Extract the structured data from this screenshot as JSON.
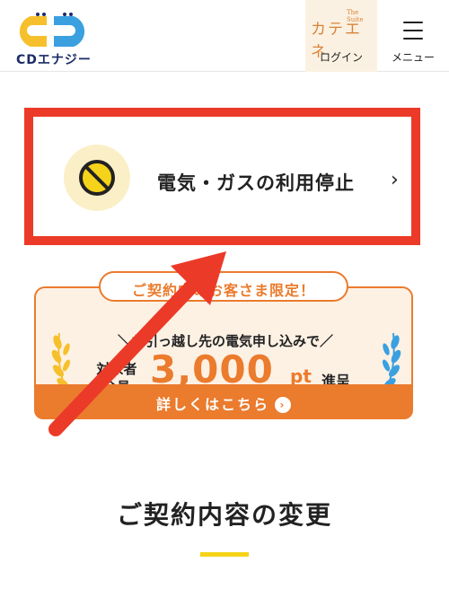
{
  "header": {
    "brand_name": "CDエナジー",
    "katene_logo": "カテエネ",
    "katene_sub": "The Suite",
    "login_label": "ログイン",
    "menu_label": "メニュー"
  },
  "stop_service": {
    "label": "電気・ガスの利用停止",
    "chevron": "›"
  },
  "campaign": {
    "badge": "ご契約中のお客さま限定！",
    "sub_line": "＼お引っ越し先の電気申し込みで／",
    "target_line1": "対象者",
    "target_line2": "全員",
    "points": "3,000",
    "points_unit": "pt",
    "points_verb": "進呈",
    "details_link": "詳しくはこちら",
    "details_arrow": "›"
  },
  "section": {
    "title": "ご契約内容の変更"
  },
  "colors": {
    "highlight_red": "#ec3a28",
    "accent_orange": "#eb7b2d",
    "accent_yellow": "#f5d31a",
    "logo_blue": "#3aa0e0",
    "logo_yellow": "#f6c02c"
  }
}
